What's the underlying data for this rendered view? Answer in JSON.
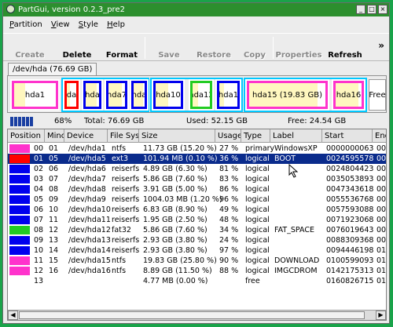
{
  "window": {
    "title": "PartGui, version 0.2.3_pre2"
  },
  "menu": [
    {
      "label": "Partition",
      "accel_index": 0
    },
    {
      "label": "View",
      "accel_index": 0
    },
    {
      "label": "Style",
      "accel_index": 0
    },
    {
      "label": "Help",
      "accel_index": 0
    }
  ],
  "toolbar": {
    "create": "Create",
    "delete": "Delete",
    "format": "Format",
    "save": "Save",
    "restore": "Restore",
    "copy": "Copy",
    "properties": "Properties",
    "refresh": "Refresh",
    "more": "»"
  },
  "disk_tab": "/dev/hda (76.69 GB)",
  "diskmap": {
    "hda1": "hda1",
    "hda5": "hda5",
    "hda6": "hda",
    "hda7": "hda7",
    "hda8": "hda",
    "hda10": "hda10",
    "hda12": "hda12",
    "hda13": "hda1",
    "hda15": "hda15 (19.83 GB)",
    "hda16": "hda16",
    "free": "Free"
  },
  "info": {
    "pct": "68%",
    "total": "Total: 76.69 GB",
    "used": "Used: 52.15 GB",
    "free": "Free: 24.54 GB"
  },
  "columns": [
    "Position",
    "Minor",
    "Device",
    "File Sys",
    "Size",
    "Usage",
    "Type",
    "Label",
    "Start",
    "End"
  ],
  "rows": [
    {
      "color": "#ff33cc",
      "pos": "00",
      "minor": "01",
      "device": "/dev/hda1",
      "fs": "ntfs",
      "size": "11.73 GB (15.20 %)",
      "usage": "27 %",
      "type": "primary",
      "label": "WindowsXP",
      "start": "0000000063",
      "end": "002"
    },
    {
      "color": "#ff0000",
      "pos": "01",
      "minor": "05",
      "device": "/dev/hda5",
      "fs": "ext3",
      "size": "101.94 MB (0.10 %)",
      "usage": "36 %",
      "type": "logical",
      "label": "BOOT",
      "start": "0024595578",
      "end": "002",
      "selected": true
    },
    {
      "color": "#0000ee",
      "pos": "02",
      "minor": "06",
      "device": "/dev/hda6",
      "fs": "reiserfs",
      "size": "4.89 GB (6.30 %)",
      "usage": "81 %",
      "type": "logical",
      "label": "",
      "start": "0024804423",
      "end": "003"
    },
    {
      "color": "#0000ee",
      "pos": "03",
      "minor": "07",
      "device": "/dev/hda7",
      "fs": "reiserfs",
      "size": "5.86 GB (7.60 %)",
      "usage": "83 %",
      "type": "logical",
      "label": "",
      "start": "0035053893",
      "end": "004"
    },
    {
      "color": "#0000ee",
      "pos": "04",
      "minor": "08",
      "device": "/dev/hda8",
      "fs": "reiserfs",
      "size": "3.91 GB (5.00 %)",
      "usage": "86 %",
      "type": "logical",
      "label": "",
      "start": "0047343618",
      "end": "005"
    },
    {
      "color": "#0000ee",
      "pos": "05",
      "minor": "09",
      "device": "/dev/hda9",
      "fs": "reiserfs",
      "size": "1004.03 MB (1.20 %)",
      "usage": "96 %",
      "type": "logical",
      "label": "",
      "start": "0055536768",
      "end": "005"
    },
    {
      "color": "#0000ee",
      "pos": "06",
      "minor": "10",
      "device": "/dev/hda10",
      "fs": "reiserfs",
      "size": "6.83 GB (8.90 %)",
      "usage": "49 %",
      "type": "logical",
      "label": "",
      "start": "0057593088",
      "end": "007"
    },
    {
      "color": "#0000ee",
      "pos": "07",
      "minor": "11",
      "device": "/dev/hda11",
      "fs": "reiserfs",
      "size": "1.95 GB (2.50 %)",
      "usage": "48 %",
      "type": "logical",
      "label": "",
      "start": "0071923068",
      "end": "007"
    },
    {
      "color": "#22cc22",
      "pos": "08",
      "minor": "12",
      "device": "/dev/hda12",
      "fs": "fat32",
      "size": "5.86 GB (7.60 %)",
      "usage": "34 %",
      "type": "logical",
      "label": "FAT_SPACE",
      "start": "0076019643",
      "end": "008"
    },
    {
      "color": "#0000ee",
      "pos": "09",
      "minor": "13",
      "device": "/dev/hda13",
      "fs": "reiserfs",
      "size": "2.93 GB (3.80 %)",
      "usage": "24 %",
      "type": "logical",
      "label": "",
      "start": "0088309368",
      "end": "009"
    },
    {
      "color": "#0000ee",
      "pos": "10",
      "minor": "14",
      "device": "/dev/hda14",
      "fs": "reiserfs",
      "size": "2.93 GB (3.80 %)",
      "usage": "97 %",
      "type": "logical",
      "label": "",
      "start": "0094446198",
      "end": "010"
    },
    {
      "color": "#ff33cc",
      "pos": "11",
      "minor": "15",
      "device": "/dev/hda15",
      "fs": "ntfs",
      "size": "19.83 GB (25.80 %)",
      "usage": "90 %",
      "type": "logical",
      "label": "DOWNLOAD",
      "start": "0100599093",
      "end": "014"
    },
    {
      "color": "#ff33cc",
      "pos": "12",
      "minor": "16",
      "device": "/dev/hda16",
      "fs": "ntfs",
      "size": "8.89 GB (11.50 %)",
      "usage": "88 %",
      "type": "logical",
      "label": "IMGCDROM",
      "start": "0142175313",
      "end": "016"
    },
    {
      "color": "",
      "pos": "13",
      "minor": "",
      "device": "",
      "fs": "",
      "size": "4.77 MB (0.00 %)",
      "usage": "",
      "type": "free",
      "label": "",
      "start": "0160826715",
      "end": "016"
    }
  ]
}
